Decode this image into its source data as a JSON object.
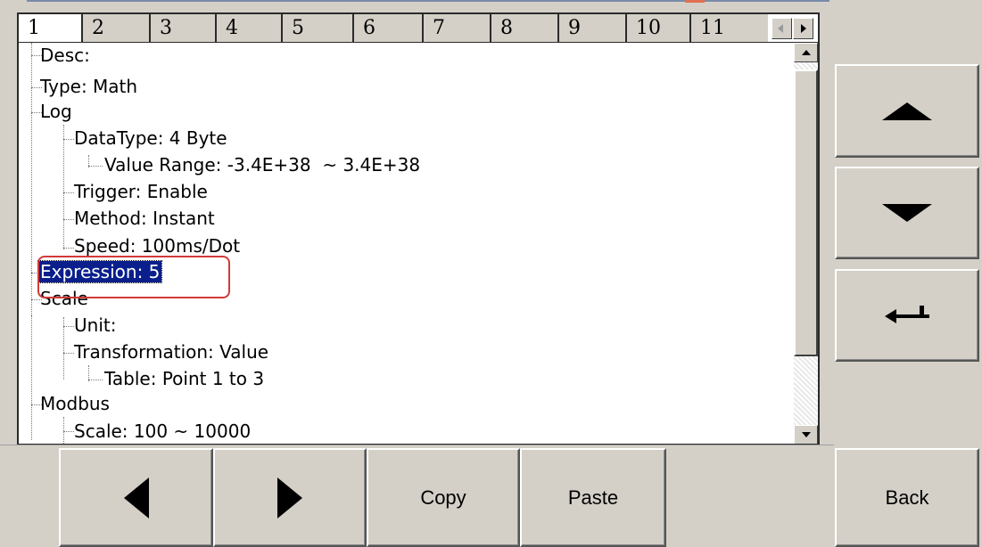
{
  "tabs": [
    "1",
    "2",
    "3",
    "4",
    "5",
    "6",
    "7",
    "8",
    "9",
    "10",
    "11"
  ],
  "active_tab_index": 0,
  "tree": {
    "nodes": [
      {
        "label": "Desc:",
        "level": 0
      },
      {
        "label": "Type: Math",
        "level": 0
      },
      {
        "label": "Log",
        "level": 0
      },
      {
        "label": "DataType: 4 Byte",
        "level": 1
      },
      {
        "label": "Value Range: -3.4E+38  ~ 3.4E+38",
        "level": 2
      },
      {
        "label": "Trigger: Enable",
        "level": 1
      },
      {
        "label": "Method: Instant",
        "level": 1
      },
      {
        "label": "Speed: 100ms/Dot",
        "level": 1
      },
      {
        "label": "Expression: 5",
        "level": 0,
        "selected": true
      },
      {
        "label": "Scale",
        "level": 0
      },
      {
        "label": "Unit:",
        "level": 1
      },
      {
        "label": "Transformation: Value",
        "level": 1
      },
      {
        "label": "Table: Point 1 to 3",
        "level": 2
      },
      {
        "label": "Modbus",
        "level": 0
      },
      {
        "label": "Scale: 100 ~ 10000",
        "level": 1
      }
    ]
  },
  "buttons": {
    "up_icon": "triangle-up-icon",
    "down_icon": "triangle-down-icon",
    "enter_icon": "enter-return-icon",
    "prev_icon": "triangle-left-icon",
    "next_icon": "triangle-right-icon",
    "copy_label": "Copy",
    "paste_label": "Paste",
    "back_label": "Back"
  },
  "colors": {
    "selection": "#0a1f8c",
    "highlight_box": "#d23a3a",
    "panel_bg": "#d4d0c8"
  }
}
